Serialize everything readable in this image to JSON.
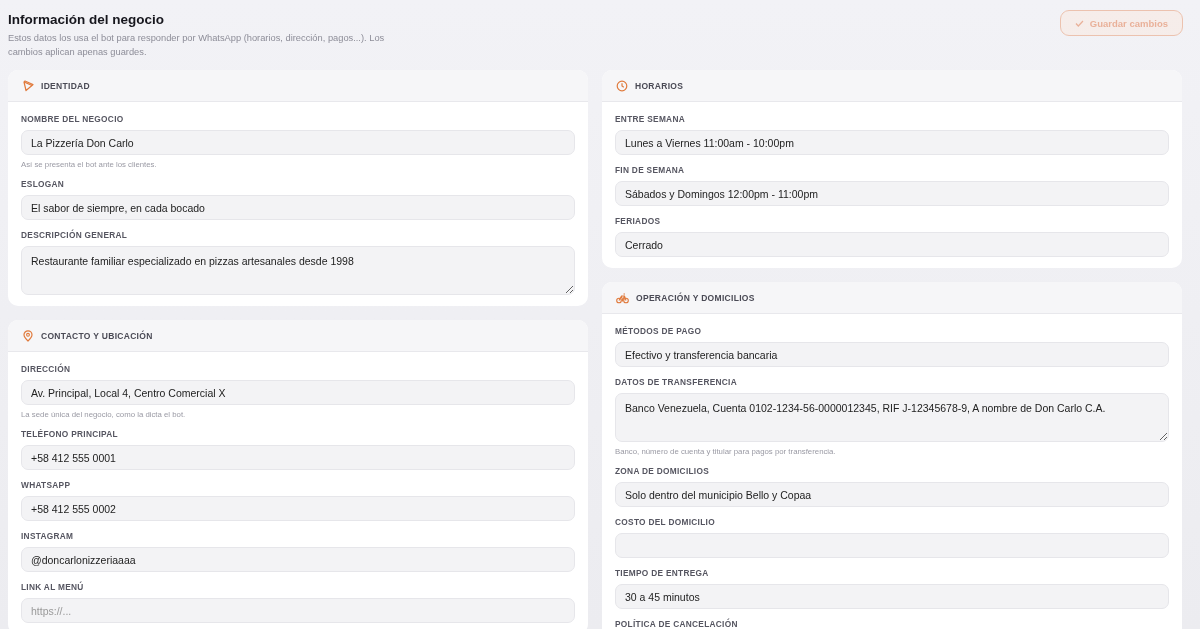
{
  "header": {
    "title": "Información del negocio",
    "subtitle": "Estos datos los usa el bot para responder por WhatsApp (horarios, dirección, pagos...). Los cambios aplican apenas guardes."
  },
  "save_button": {
    "label": "Guardar cambios",
    "disabled": true
  },
  "columns": [
    [
      {
        "title": "IDENTIDAD",
        "fields": [
          {
            "kind": "input",
            "label": "NOMBRE DEL NEGOCIO",
            "value": "La Pizzería Don Carlo",
            "hint": "Así se presenta el bot ante los clientes."
          },
          {
            "kind": "input",
            "label": "ESLOGAN",
            "value": "El sabor de siempre, en cada bocado"
          },
          {
            "kind": "textarea",
            "label": "DESCRIPCIÓN GENERAL",
            "value": "Restaurante familiar especializado en pizzas artesanales desde 1998"
          }
        ]
      },
      {
        "title": "CONTACTO Y UBICACIÓN",
        "fields": [
          {
            "kind": "input",
            "label": "DIRECCIÓN",
            "value": "Av. Principal, Local 4, Centro Comercial X",
            "hint": "La sede única del negocio, como la dicta el bot."
          },
          {
            "kind": "input",
            "label": "TELÉFONO PRINCIPAL",
            "value": "+58 412 555 0001"
          },
          {
            "kind": "input",
            "label": "WHATSAPP",
            "value": "+58 412 555 0002"
          },
          {
            "kind": "input",
            "label": "INSTAGRAM",
            "value": "@doncarlonizzeriaaaa"
          },
          {
            "kind": "input",
            "label": "LINK AL MENÚ",
            "placeholder": "https://..."
          }
        ]
      }
    ],
    [
      {
        "title": "HORARIOS",
        "fields": [
          {
            "kind": "input",
            "label": "ENTRE SEMANA",
            "value": "Lunes a Viernes 11:00am - 10:00pm"
          },
          {
            "kind": "input",
            "label": "FIN DE SEMANA",
            "value": "Sábados y Domingos 12:00pm - 11:00pm"
          },
          {
            "kind": "input",
            "label": "FERIADOS",
            "value": "Cerrado"
          }
        ]
      },
      {
        "title": "OPERACIÓN Y DOMICILIOS",
        "fields": [
          {
            "kind": "input",
            "label": "MÉTODOS DE PAGO",
            "value": "Efectivo y transferencia bancaria"
          },
          {
            "kind": "textarea",
            "label": "DATOS DE TRANSFERENCIA",
            "value": "Banco Venezuela, Cuenta 0102-1234-56-0000012345, RIF J-12345678-9, A nombre de Don Carlo C.A.",
            "hint": "Banco, número de cuenta y titular para pagos por transferencia."
          },
          {
            "kind": "input",
            "label": "ZONA DE DOMICILIOS",
            "value": "Solo dentro del municipio Bello y Copaa"
          },
          {
            "kind": "input",
            "label": "COSTO DEL DOMICILIO"
          },
          {
            "kind": "input",
            "label": "TIEMPO DE ENTREGA",
            "value": "30 a 45 minutos"
          },
          {
            "kind": "label",
            "label": "POLÍTICA DE CANCELACIÓN"
          }
        ]
      }
    ]
  ]
}
